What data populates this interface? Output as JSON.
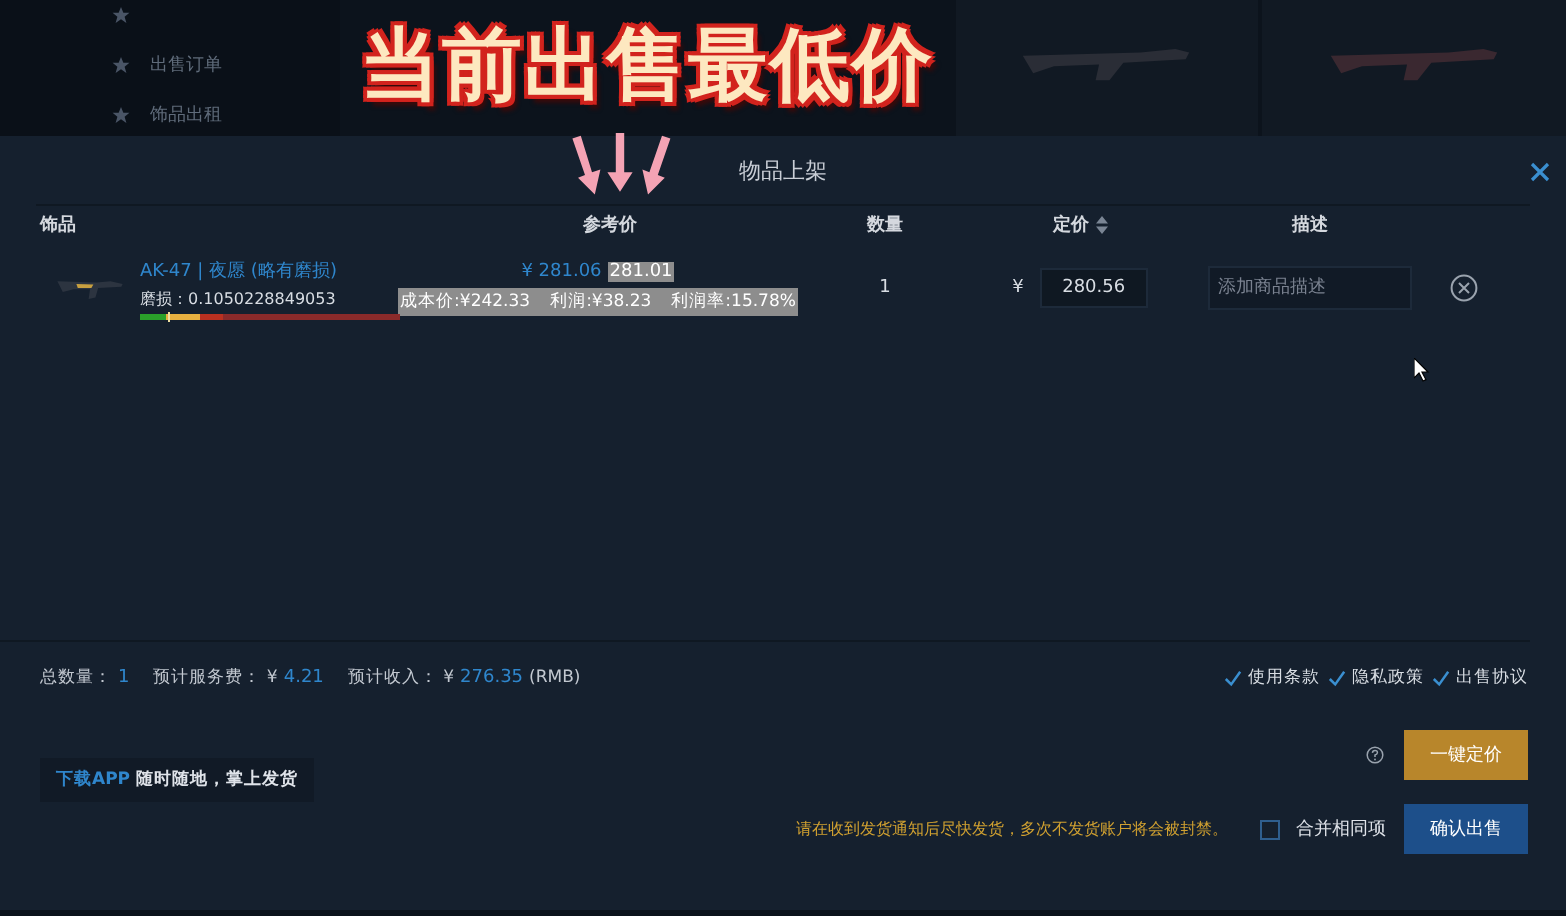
{
  "background": {
    "sidebar_items": [
      {
        "label": "出售订单"
      },
      {
        "label": "饰品出租"
      }
    ]
  },
  "annotation": {
    "text": "当前出售最低价"
  },
  "dialog": {
    "title": "物品上架",
    "columns": [
      {
        "label": "饰品",
        "sortable": false
      },
      {
        "label": "参考价",
        "sortable": false
      },
      {
        "label": "数量",
        "sortable": false
      },
      {
        "label": "定价",
        "sortable": true
      },
      {
        "label": "描述",
        "sortable": false
      }
    ],
    "rows": [
      {
        "name": "AK-47 | 夜愿 (略有磨损)",
        "wear": "磨损：0.1050228849053",
        "level": 0.11,
        "ref_price": "¥ 281.06",
        "lowest_price": "281.01",
        "cost": "成本价:¥242.33",
        "profit": "利润:¥38.23",
        "margin": "利润率:15.78%",
        "quantity": "1",
        "currency": "¥",
        "price": "280.56",
        "description_placeholder": "添加商品描述"
      }
    ],
    "summary": [
      {
        "label": "总数量：",
        "value": "1"
      },
      {
        "label": "预计服务费： ¥",
        "value": "4.21"
      },
      {
        "label": "预计收入： ¥",
        "value": "276.35",
        "suffix": "(RMB)"
      }
    ],
    "agreements": [
      {
        "label": "使用条款",
        "checked": true
      },
      {
        "label": "隐私政策",
        "checked": true
      },
      {
        "label": "出售协议",
        "checked": true
      }
    ],
    "app_promo": {
      "link": "下载APP",
      "text": "随时随地，掌上发货"
    },
    "warning": "请在收到发货通知后尽快发货，多次不发货账户将会被封禁。",
    "merge": {
      "label": "合并相同项",
      "checked": false
    },
    "buttons": [
      {
        "label": "一键定价",
        "kind": "secondary"
      },
      {
        "label": "确认出售",
        "kind": "primary"
      }
    ]
  }
}
